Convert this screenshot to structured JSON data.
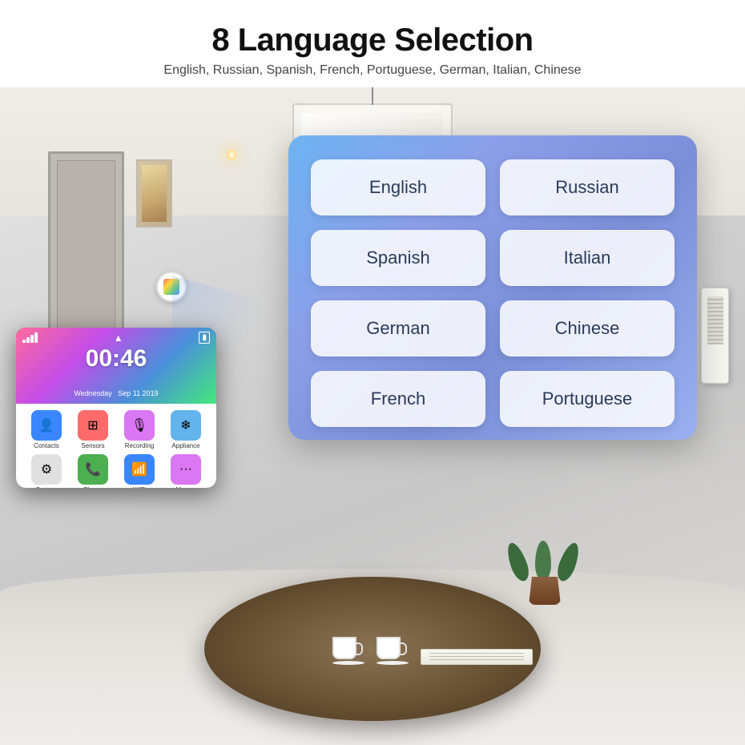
{
  "header": {
    "title": "8 Language Selection",
    "subtitle": "English, Russian, Spanish, French, Portuguese, German, Italian, Chinese"
  },
  "language_panel": {
    "languages": [
      {
        "id": "english",
        "label": "English"
      },
      {
        "id": "russian",
        "label": "Russian"
      },
      {
        "id": "spanish",
        "label": "Spanish"
      },
      {
        "id": "italian",
        "label": "Italian"
      },
      {
        "id": "german",
        "label": "German"
      },
      {
        "id": "chinese",
        "label": "Chinese"
      },
      {
        "id": "french",
        "label": "French"
      },
      {
        "id": "portuguese",
        "label": "Portuguese"
      }
    ]
  },
  "phone": {
    "time": "00:46",
    "day": "Wednesday",
    "date": "Sep 11 2019",
    "apps": [
      {
        "label": "Contacts",
        "color": "#3a86ff",
        "icon": "👤"
      },
      {
        "label": "Sensors",
        "color": "#ff6b6b",
        "icon": "⊞"
      },
      {
        "label": "Recording",
        "color": "#da77f2",
        "icon": "🎙"
      },
      {
        "label": "Appliance",
        "color": "#63b3ed",
        "icon": "❄"
      },
      {
        "label": "System",
        "color": "#e0e0e0",
        "icon": "⚙"
      },
      {
        "label": "Phone",
        "color": "#4caf50",
        "icon": "📞"
      },
      {
        "label": "WiFi",
        "color": "#3a86ff",
        "icon": "📶"
      },
      {
        "label": "More...",
        "color": "#da77f2",
        "icon": "···"
      }
    ]
  },
  "colors": {
    "panel_gradient_start": "#6db3f2",
    "panel_gradient_end": "#9ab0f0",
    "button_bg": "rgba(255,255,255,0.85)",
    "button_text": "#2a3a5a"
  }
}
